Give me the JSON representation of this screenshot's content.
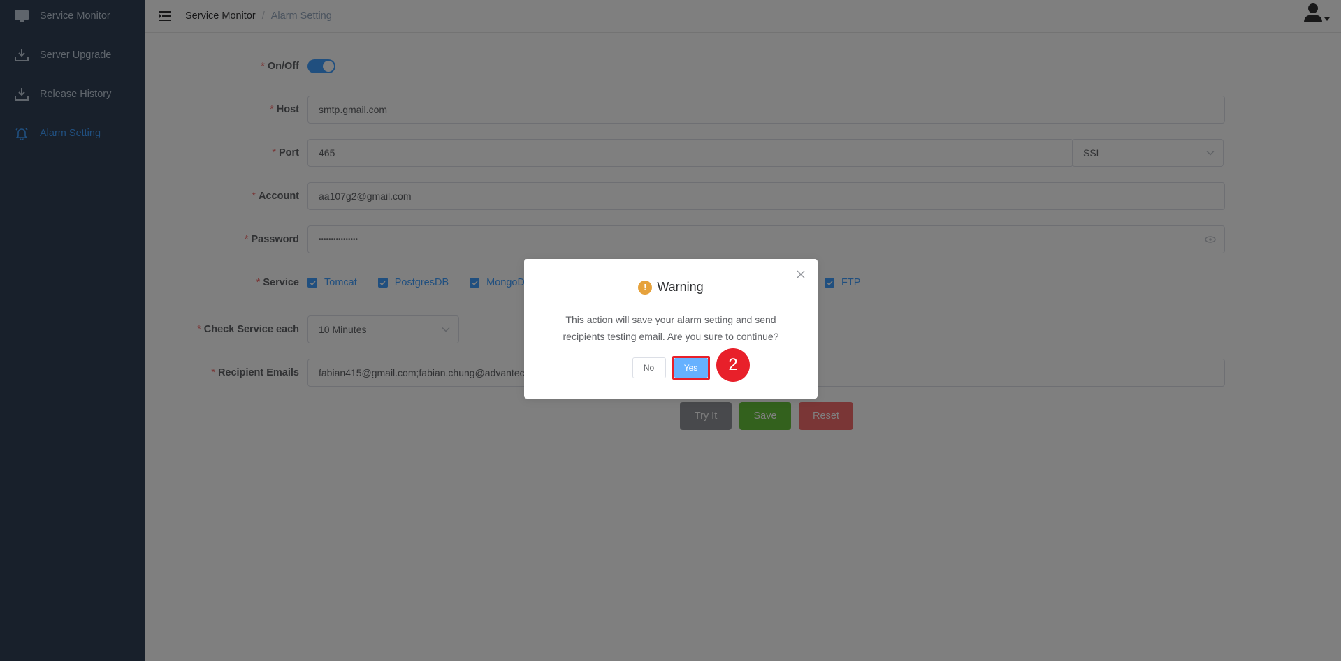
{
  "sidebar": {
    "items": [
      {
        "label": "Service Monitor",
        "icon": "monitor-icon"
      },
      {
        "label": "Server Upgrade",
        "icon": "download-icon"
      },
      {
        "label": "Release History",
        "icon": "download-icon"
      },
      {
        "label": "Alarm Setting",
        "icon": "bell-icon"
      }
    ],
    "active_index": 3,
    "bg_color": "#304156",
    "active_color": "#409eff"
  },
  "header": {
    "breadcrumb": [
      "Service Monitor",
      "Alarm Setting"
    ],
    "separator": "/"
  },
  "form": {
    "onoff": {
      "label": "On/Off",
      "value": true
    },
    "host": {
      "label": "Host",
      "value": "smtp.gmail.com"
    },
    "port": {
      "label": "Port",
      "value": "465",
      "security": "SSL"
    },
    "account": {
      "label": "Account",
      "value": "aa107g2@gmail.com"
    },
    "password": {
      "label": "Password",
      "value": "••••••••••••••••"
    },
    "service": {
      "label": "Service",
      "options": [
        "Tomcat",
        "PostgresDB",
        "MongoDB",
        "FTP"
      ]
    },
    "check_interval": {
      "label": "Check Service each",
      "value": "10 Minutes"
    },
    "recipients": {
      "label": "Recipient Emails",
      "value": "fabian415@gmail.com;fabian.chung@advantech"
    },
    "buttons": {
      "try": "Try It",
      "save": "Save",
      "reset": "Reset"
    },
    "colors": {
      "try": "#909399",
      "save": "#67c23a",
      "reset": "#f56c6c"
    }
  },
  "dialog": {
    "title": "Warning",
    "message_line1": "This action will save your alarm setting and send",
    "message_line2": "recipients testing email. Are you sure to continue?",
    "no": "No",
    "yes": "Yes"
  },
  "annotation": {
    "step": "2"
  }
}
